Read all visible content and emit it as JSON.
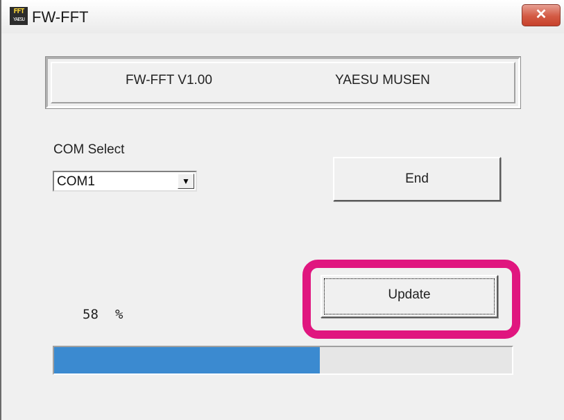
{
  "window": {
    "title": "FW-FFT",
    "icon_name": "fft-app-icon",
    "icon_text_top": "FFT",
    "icon_text_bottom": "YAESU",
    "close_glyph": "✕"
  },
  "header": {
    "version": "FW-FFT  V1.00",
    "maker": "YAESU MUSEN"
  },
  "com": {
    "label": "COM Select",
    "selected": "COM1",
    "arrow": "▼"
  },
  "buttons": {
    "end_label": "End",
    "update_label": "Update"
  },
  "progress": {
    "percent_text": "58",
    "percent_sign": "%",
    "fraction": 0.58,
    "fill_color": "#3b8ad0"
  },
  "colors": {
    "highlight": "#e0167f",
    "close_button": "#d35a43"
  }
}
